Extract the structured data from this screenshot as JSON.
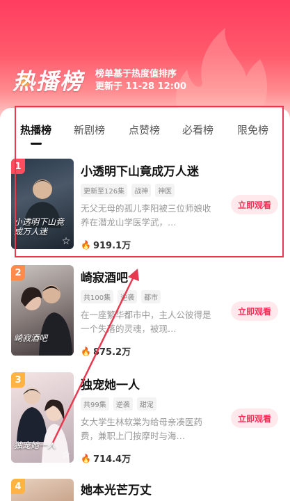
{
  "header": {
    "title": "热播榜",
    "subtitle_line1": "榜单基于热度值排序",
    "subtitle_line2": "更新于 11-28 12:00"
  },
  "tabs": [
    {
      "label": "热播榜",
      "active": true
    },
    {
      "label": "新剧榜",
      "active": false
    },
    {
      "label": "点赞榜",
      "active": false
    },
    {
      "label": "必看榜",
      "active": false
    },
    {
      "label": "限免榜",
      "active": false
    }
  ],
  "items": [
    {
      "rank": "1",
      "rank_color": "#ff4d5e",
      "title": "小透明下山竟成万人迷",
      "poster_text": "小透明下山竟成万人迷",
      "tags": [
        "更新至126集",
        "战神",
        "神医"
      ],
      "description": "无父无母的孤儿李阳被三位师娘收养在潜龙山学医学武，…",
      "heat": "919.1万",
      "button": "立即观看"
    },
    {
      "rank": "2",
      "rank_color": "#ff8a4a",
      "title": "崎寂酒吧",
      "poster_text": "崎寂酒吧",
      "tags": [
        "共100集",
        "逆袭",
        "都市"
      ],
      "description": "在一座繁华都市中，主人公彼得是一个失落的灵魂，被现…",
      "heat": "875.2万",
      "button": "立即观看"
    },
    {
      "rank": "3",
      "rank_color": "#ffb340",
      "title": "独宠她一人",
      "poster_text": "独宠她一人",
      "tags": [
        "共99集",
        "逆袭",
        "甜宠"
      ],
      "description": "女大学生林软棠为给母亲凑医药费，兼职上门按摩时与海…",
      "heat": "714.4万",
      "button": "立即观看"
    },
    {
      "rank": "4",
      "rank_color": "#ffb340",
      "title": "她本光芒万丈"
    }
  ],
  "colors": {
    "accent": "#ff2d55",
    "annotation": "#e8384f"
  }
}
